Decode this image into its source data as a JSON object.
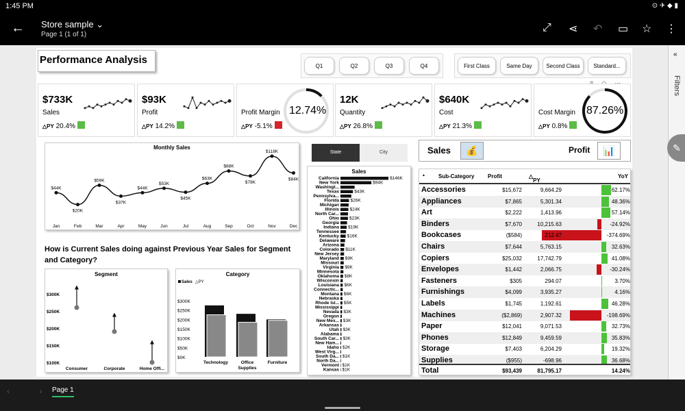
{
  "status": {
    "time": "1:45 PM",
    "icons": "⊙ ✈ ◆ ▮"
  },
  "appbar": {
    "title": "Store sample",
    "subtitle": "Page 1 (1 of 1)"
  },
  "filters_label": "Filters",
  "page_tab": "Page 1",
  "report": {
    "title": "Performance Analysis",
    "quarters": [
      "Q1",
      "Q2",
      "Q3",
      "Q4"
    ],
    "ship_modes": [
      "First Class",
      "Same Day",
      "Second Class",
      "Standard..."
    ],
    "cards": [
      {
        "value": "$733K",
        "label": "Sales",
        "py_label": "PY",
        "py": "20.4%",
        "color": "#5dbb46",
        "spark": [
          8,
          7,
          8,
          6,
          7,
          6,
          5,
          6,
          4,
          5,
          3,
          4
        ]
      },
      {
        "value": "$93K",
        "label": "Profit",
        "py_label": "PY",
        "py": "14.2%",
        "color": "#5dbb46",
        "spark": [
          7,
          8,
          2,
          8,
          5,
          6,
          4,
          6,
          5,
          4,
          5,
          4
        ]
      },
      {
        "label": "Profit Margin",
        "py_label": "PY",
        "py": "-5.1%",
        "color": "#d4242b",
        "gauge": "12.74%",
        "fraction": 0.1274
      },
      {
        "value": "12K",
        "label": "Quantity",
        "py_label": "PY",
        "py": "26.8%",
        "color": "#5dbb46",
        "spark": [
          8,
          7,
          6,
          7,
          5,
          6,
          5,
          6,
          4,
          5,
          2,
          4
        ]
      },
      {
        "value": "$640K",
        "label": "Cost",
        "py_label": "PY",
        "py": "21.3%",
        "color": "#5dbb46",
        "spark": [
          8,
          6,
          7,
          6,
          5,
          6,
          5,
          7,
          4,
          5,
          3,
          4
        ]
      },
      {
        "label": "Cost Margin",
        "py_label": "PY",
        "py": "0.8%",
        "color": "#5dbb46",
        "gauge": "87.26%",
        "fraction": 0.8726
      }
    ],
    "question": "How is  Current Sales doing against Previous Year Sales for Segment and Category?",
    "state_toggle": {
      "on": "State",
      "off": "City"
    },
    "sp_toggle": {
      "sales": "Sales",
      "profit": "Profit"
    },
    "table": {
      "headers": {
        "sub": "Sub-Category",
        "profit": "Profit",
        "py": "PY",
        "yoy": "YoY"
      },
      "rows": [
        {
          "name": "Accessories",
          "profit": "$15,672",
          "py": "9,664.29",
          "yoy": "62.17%",
          "val": 62.17
        },
        {
          "name": "Appliances",
          "profit": "$7,865",
          "py": "5,301.34",
          "yoy": "48.36%",
          "val": 48.36
        },
        {
          "name": "Art",
          "profit": "$2,222",
          "py": "1,413.96",
          "yoy": "57.14%",
          "val": 57.14
        },
        {
          "name": "Binders",
          "profit": "$7,670",
          "py": "10,215.63",
          "yoy": "-24.92%",
          "val": -24.92
        },
        {
          "name": "Bookcases",
          "profit": "($584)",
          "py": "212.47",
          "yoy": "-374.69%",
          "val": -374.69
        },
        {
          "name": "Chairs",
          "profit": "$7,644",
          "py": "5,763.15",
          "yoy": "32.63%",
          "val": 32.63
        },
        {
          "name": "Copiers",
          "profit": "$25,032",
          "py": "17,742.79",
          "yoy": "41.08%",
          "val": 41.08
        },
        {
          "name": "Envelopes",
          "profit": "$1,442",
          "py": "2,066.75",
          "yoy": "-30.24%",
          "val": -30.24
        },
        {
          "name": "Fasteners",
          "profit": "$305",
          "py": "294.07",
          "yoy": "3.70%",
          "val": 3.7
        },
        {
          "name": "Furnishings",
          "profit": "$4,099",
          "py": "3,935.27",
          "yoy": "4.16%",
          "val": 4.16
        },
        {
          "name": "Labels",
          "profit": "$1,745",
          "py": "1,192.61",
          "yoy": "46.28%",
          "val": 46.28
        },
        {
          "name": "Machines",
          "profit": "($2,869)",
          "py": "2,907.32",
          "yoy": "-198.69%",
          "val": -198.69
        },
        {
          "name": "Paper",
          "profit": "$12,041",
          "py": "9,071.53",
          "yoy": "32.73%",
          "val": 32.73
        },
        {
          "name": "Phones",
          "profit": "$12,849",
          "py": "9,459.59",
          "yoy": "35.83%",
          "val": 35.83
        },
        {
          "name": "Storage",
          "profit": "$7,403",
          "py": "6,204.29",
          "yoy": "19.32%",
          "val": 19.32
        },
        {
          "name": "Supplies",
          "profit": "($955)",
          "py": "-698.96",
          "yoy": "36.68%",
          "val": 36.68
        }
      ],
      "total": {
        "name": "Total",
        "profit": "$93,439",
        "py": "81,795.17",
        "yoy": "14.24%"
      },
      "pos_color": "#4cc23a",
      "neg_color": "#c8131b"
    }
  },
  "chart_data": [
    {
      "type": "line",
      "title": "Monthly Sales",
      "categories": [
        "Jan",
        "Feb",
        "Mar",
        "Apr",
        "May",
        "Jun",
        "Jul",
        "Aug",
        "Sep",
        "Oct",
        "Nov",
        "Dec"
      ],
      "values": [
        44,
        20,
        59,
        37,
        44,
        53,
        45,
        63,
        88,
        78,
        118,
        84
      ],
      "labels": [
        "$44K",
        "$20K",
        "$59K",
        "$37K",
        "$44K",
        "$53K",
        "$45K",
        "$63K",
        "$88K",
        "$78K",
        "$118K",
        "$84K"
      ]
    },
    {
      "type": "bar",
      "title": "Sales",
      "orientation": "horizontal",
      "categories": [
        "California",
        "New York",
        "Washingt...",
        "Texas",
        "Pennsylva...",
        "Florida",
        "Michigan",
        "Illinois",
        "North Car...",
        "Ohio",
        "Georgia",
        "Indiana",
        "Tennessee",
        "Kentucky",
        "Delaware",
        "Arizona",
        "Colorado",
        "New Jersey",
        "Maryland",
        "Missouri",
        "Virginia",
        "Minnesota",
        "Oklahoma",
        "Wisconsin",
        "Louisiana",
        "Connectic...",
        "Montana",
        "Nebraska",
        "Rhode Isl...",
        "Mississippi",
        "Nevada",
        "Oregon",
        "New Mex...",
        "Arkansas",
        "Utah",
        "Alabama",
        "South Car...",
        "New Ham...",
        "Idaho",
        "West Virg...",
        "South Da...",
        "North Da...",
        "Vermont",
        "Kansas"
      ],
      "values": [
        146,
        94,
        43,
        38,
        33,
        26,
        25,
        24,
        23,
        23,
        20,
        19,
        17,
        16,
        14,
        12,
        11,
        11,
        10,
        10,
        9,
        9,
        8,
        7,
        7,
        7,
        6,
        6,
        6,
        5,
        5,
        4,
        4,
        3,
        3,
        3,
        3,
        2,
        2,
        2,
        2,
        1.5,
        1,
        1
      ],
      "value_labels": {
        "0": "$146K",
        "1": "$94K",
        "3": "$43K",
        "5": "$26K",
        "7": "$24K",
        "9": "$23K",
        "11": "$19K",
        "13": "$16K",
        "16": "$11K",
        "18": "$9K",
        "20": "$9K",
        "22": "$8K",
        "24": "$6K",
        "26": "$6K",
        "28": "$5K",
        "30": "$3K",
        "32": "$3K",
        "34": "$3K",
        "36": "$3K",
        "38": "$2K",
        "40": "$1K",
        "42": "$1K",
        "43": "$1K"
      }
    },
    {
      "type": "scatter",
      "title": "Segment",
      "categories": [
        "Consumer",
        "Corporate",
        "Home Offi..."
      ],
      "py": [
        260,
        190,
        100
      ],
      "sales": [
        325,
        245,
        165
      ],
      "y_ticks": [
        "$300K",
        "$250K",
        "$200K",
        "$150K",
        "$100K"
      ],
      "ylim": [
        100,
        300
      ]
    },
    {
      "type": "bar",
      "title": "Category",
      "legend": [
        "Sales",
        "PY"
      ],
      "categories": [
        "Technology",
        "Office Supplies",
        "Furniture"
      ],
      "series": [
        {
          "name": "Sales",
          "values": [
            275,
            230,
            200
          ]
        },
        {
          "name": "PY",
          "values": [
            225,
            185,
            195
          ]
        }
      ],
      "y_ticks": [
        "$300K",
        "$250K",
        "$200K",
        "$150K",
        "$100K",
        "$50K",
        "$0K"
      ],
      "ylim": [
        0,
        300
      ]
    }
  ]
}
